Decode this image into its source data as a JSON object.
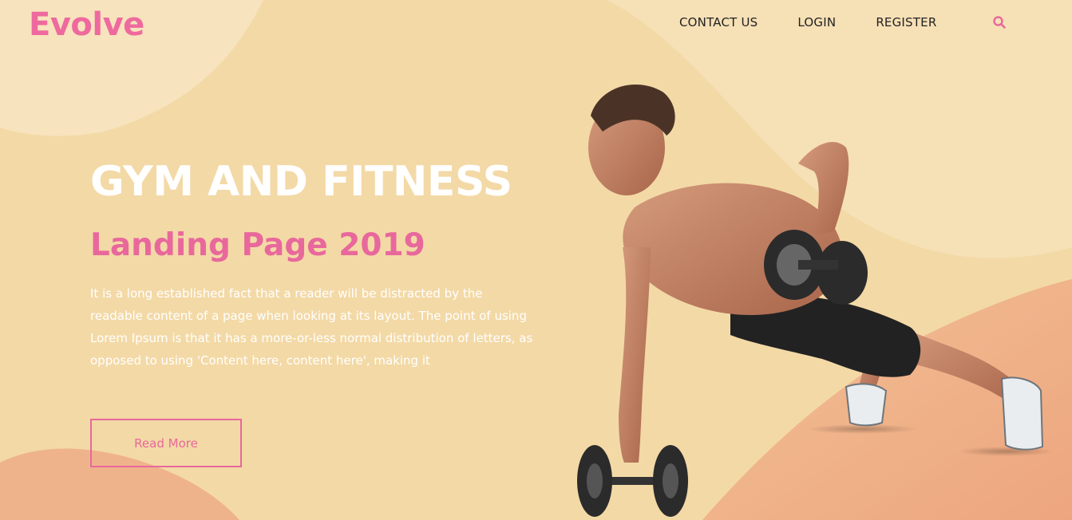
{
  "brand": {
    "logo_text": "Evolve"
  },
  "nav": {
    "items": [
      {
        "label": "CONTACT US"
      },
      {
        "label": "LOGIN"
      },
      {
        "label": "REGISTER"
      }
    ],
    "search_icon": "search-icon"
  },
  "hero": {
    "title": "GYM AND FITNESS",
    "subtitle": "Landing Page 2019",
    "body": "It is a long established fact that a reader will be distracted by the readable content of a page when looking at its layout. The point of using Lorem Ipsum is that it has a more-or-less normal distribution of letters, as opposed to using 'Content here, content here', making it",
    "cta_label": "Read More",
    "image": "man-doing-dumbbell-plank-row"
  },
  "colors": {
    "accent": "#e8689c",
    "background": "#f3d9a6",
    "blob_light": "#f8e6c2",
    "blob_peach": "#efb08a"
  }
}
